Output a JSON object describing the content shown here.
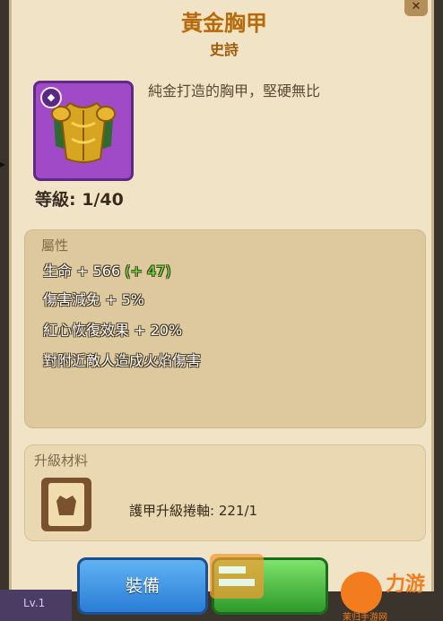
{
  "item": {
    "name": "黃金胸甲",
    "rarity": "史詩",
    "description": "純金打造的胸甲，堅硬無比",
    "level_label": "等級: 1/40",
    "badge_icon": "shield-icon"
  },
  "attributes": {
    "header": "屬性",
    "items": [
      {
        "label": "生命",
        "value": "+ 566",
        "bonus": "(+ 47)"
      },
      {
        "label": "傷害減免",
        "value": "+ 5%",
        "bonus": ""
      },
      {
        "label": "紅心恢復效果",
        "value": "+ 20%",
        "bonus": ""
      },
      {
        "label": "對附近敵人造成火焰傷害",
        "value": "",
        "bonus": ""
      }
    ]
  },
  "materials": {
    "header": "升級材料",
    "item_text": "護甲升級捲軸: 221/1"
  },
  "buttons": {
    "equip": "裝備"
  },
  "footer": {
    "level_tag": "Lv.1"
  },
  "watermark": {
    "brand": "力游",
    "site": "茉归手游网"
  },
  "colors": {
    "title": "#b66a0e",
    "bonus": "#5eea3a",
    "equip_button": "#2a7cd6",
    "upgrade_button": "#2e9a2a",
    "icon_bg": "#a04ac8"
  }
}
